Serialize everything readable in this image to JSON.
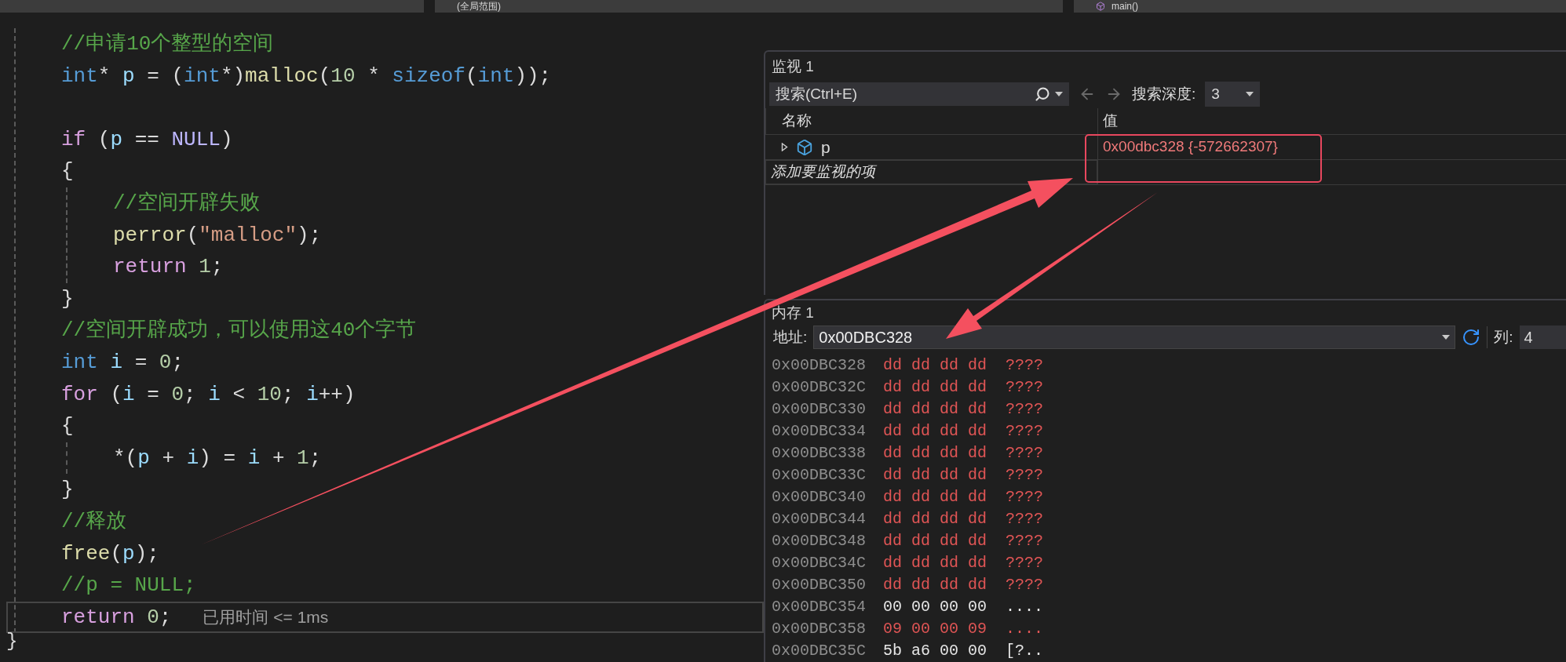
{
  "toolbar": {
    "scopes": [
      {
        "label": "(全局范围)"
      },
      {
        "label": "main()"
      }
    ]
  },
  "editor": {
    "lines": [
      {
        "kind": "code",
        "tokens": [
          {
            "t": "//申请10个整型的空间",
            "kind": "comment"
          }
        ]
      },
      {
        "kind": "code",
        "tokens": [
          {
            "t": "int",
            "kind": "type"
          },
          {
            "t": "* ",
            "kind": "plain"
          },
          {
            "t": "p",
            "kind": "var"
          },
          {
            "t": " = (",
            "kind": "plain"
          },
          {
            "t": "int",
            "kind": "type"
          },
          {
            "t": "*)",
            "kind": "plain"
          },
          {
            "t": "malloc",
            "kind": "func"
          },
          {
            "t": "(",
            "kind": "plain"
          },
          {
            "t": "10",
            "kind": "num"
          },
          {
            "t": " * ",
            "kind": "plain"
          },
          {
            "t": "sizeof",
            "kind": "type"
          },
          {
            "t": "(",
            "kind": "plain"
          },
          {
            "t": "int",
            "kind": "type"
          },
          {
            "t": "));",
            "kind": "plain"
          }
        ]
      },
      {
        "kind": "blank"
      },
      {
        "kind": "code",
        "tokens": [
          {
            "t": "if",
            "kind": "keyword"
          },
          {
            "t": " (",
            "kind": "plain"
          },
          {
            "t": "p",
            "kind": "var"
          },
          {
            "t": " == ",
            "kind": "plain"
          },
          {
            "t": "NULL",
            "kind": "macro"
          },
          {
            "t": ")",
            "kind": "plain"
          }
        ]
      },
      {
        "kind": "code",
        "tokens": [
          {
            "t": "{",
            "kind": "plain"
          }
        ]
      },
      {
        "kind": "block",
        "children": [
          {
            "kind": "code",
            "tokens": [
              {
                "t": "//空间开辟失败",
                "kind": "comment"
              }
            ]
          },
          {
            "kind": "code",
            "tokens": [
              {
                "t": "perror",
                "kind": "func"
              },
              {
                "t": "(",
                "kind": "plain"
              },
              {
                "t": "\"malloc\"",
                "kind": "string"
              },
              {
                "t": ");",
                "kind": "plain"
              }
            ]
          },
          {
            "kind": "code",
            "tokens": [
              {
                "t": "return ",
                "kind": "keyword"
              },
              {
                "t": "1",
                "kind": "num"
              },
              {
                "t": ";",
                "kind": "plain"
              }
            ]
          }
        ]
      },
      {
        "kind": "code",
        "tokens": [
          {
            "t": "}",
            "kind": "plain"
          }
        ]
      },
      {
        "kind": "code",
        "tokens": [
          {
            "t": "//空间开辟成功，可以使用这40个字节",
            "kind": "comment"
          }
        ]
      },
      {
        "kind": "code",
        "tokens": [
          {
            "t": "int ",
            "kind": "type"
          },
          {
            "t": "i",
            "kind": "var"
          },
          {
            "t": " = ",
            "kind": "plain"
          },
          {
            "t": "0",
            "kind": "num"
          },
          {
            "t": ";",
            "kind": "plain"
          }
        ]
      },
      {
        "kind": "code",
        "tokens": [
          {
            "t": "for",
            "kind": "keyword"
          },
          {
            "t": " (",
            "kind": "plain"
          },
          {
            "t": "i",
            "kind": "var"
          },
          {
            "t": " = ",
            "kind": "plain"
          },
          {
            "t": "0",
            "kind": "num"
          },
          {
            "t": "; ",
            "kind": "plain"
          },
          {
            "t": "i",
            "kind": "var"
          },
          {
            "t": " < ",
            "kind": "plain"
          },
          {
            "t": "10",
            "kind": "num"
          },
          {
            "t": "; ",
            "kind": "plain"
          },
          {
            "t": "i",
            "kind": "var"
          },
          {
            "t": "++)",
            "kind": "plain"
          }
        ]
      },
      {
        "kind": "code",
        "tokens": [
          {
            "t": "{",
            "kind": "plain"
          }
        ]
      },
      {
        "kind": "block",
        "children": [
          {
            "kind": "code",
            "tokens": [
              {
                "t": "*(",
                "kind": "plain"
              },
              {
                "t": "p",
                "kind": "var"
              },
              {
                "t": " + ",
                "kind": "plain"
              },
              {
                "t": "i",
                "kind": "var"
              },
              {
                "t": ") = ",
                "kind": "plain"
              },
              {
                "t": "i",
                "kind": "var"
              },
              {
                "t": " + ",
                "kind": "plain"
              },
              {
                "t": "1",
                "kind": "num"
              },
              {
                "t": ";",
                "kind": "plain"
              }
            ]
          }
        ]
      },
      {
        "kind": "code",
        "tokens": [
          {
            "t": "}",
            "kind": "plain"
          }
        ]
      },
      {
        "kind": "code",
        "tokens": [
          {
            "t": "//释放",
            "kind": "comment"
          }
        ]
      },
      {
        "kind": "code",
        "tokens": [
          {
            "t": "free",
            "kind": "func"
          },
          {
            "t": "(",
            "kind": "plain"
          },
          {
            "t": "p",
            "kind": "var"
          },
          {
            "t": ");",
            "kind": "plain"
          }
        ]
      },
      {
        "kind": "code",
        "tokens": [
          {
            "t": "//p = NULL;",
            "kind": "comment"
          }
        ]
      }
    ],
    "current_line": {
      "tokens": [
        {
          "t": "return ",
          "kind": "keyword"
        },
        {
          "t": "0",
          "kind": "num"
        },
        {
          "t": ";",
          "kind": "plain"
        }
      ],
      "hint": "已用时间 <= 1ms"
    },
    "closing_brace": "}"
  },
  "watch": {
    "title": "监视 1",
    "search": {
      "placeholder": "搜索(Ctrl+E)"
    },
    "depth_label": "搜索深度:",
    "depth": "3",
    "columns": [
      "名称",
      "值"
    ],
    "rows": [
      {
        "name": "p",
        "value": "0x00dbc328 {-572662307}",
        "changed": true,
        "expanded": false
      }
    ],
    "add_placeholder": "添加要监视的项"
  },
  "memory": {
    "title": "内存 1",
    "address_label": "地址:",
    "address": "0x00DBC328",
    "columns_label": "列:",
    "columns": "4",
    "rows": [
      {
        "address": "0x00DBC328",
        "bytes": "dd dd dd dd",
        "chars": "????",
        "changed": true
      },
      {
        "address": "0x00DBC32C",
        "bytes": "dd dd dd dd",
        "chars": "????",
        "changed": true
      },
      {
        "address": "0x00DBC330",
        "bytes": "dd dd dd dd",
        "chars": "????",
        "changed": true
      },
      {
        "address": "0x00DBC334",
        "bytes": "dd dd dd dd",
        "chars": "????",
        "changed": true
      },
      {
        "address": "0x00DBC338",
        "bytes": "dd dd dd dd",
        "chars": "????",
        "changed": true
      },
      {
        "address": "0x00DBC33C",
        "bytes": "dd dd dd dd",
        "chars": "????",
        "changed": true
      },
      {
        "address": "0x00DBC340",
        "bytes": "dd dd dd dd",
        "chars": "????",
        "changed": true
      },
      {
        "address": "0x00DBC344",
        "bytes": "dd dd dd dd",
        "chars": "????",
        "changed": true
      },
      {
        "address": "0x00DBC348",
        "bytes": "dd dd dd dd",
        "chars": "????",
        "changed": true
      },
      {
        "address": "0x00DBC34C",
        "bytes": "dd dd dd dd",
        "chars": "????",
        "changed": true
      },
      {
        "address": "0x00DBC350",
        "bytes": "dd dd dd dd",
        "chars": "????",
        "changed": true
      },
      {
        "address": "0x00DBC354",
        "bytes": "00 00 00 00",
        "chars": "....",
        "changed": false
      },
      {
        "address": "0x00DBC358",
        "bytes": "09 00 00 09",
        "chars": "....",
        "changed": true
      },
      {
        "address": "0x00DBC35C",
        "bytes": "5b a6 00 00",
        "chars": "[?..",
        "changed": false
      }
    ]
  }
}
